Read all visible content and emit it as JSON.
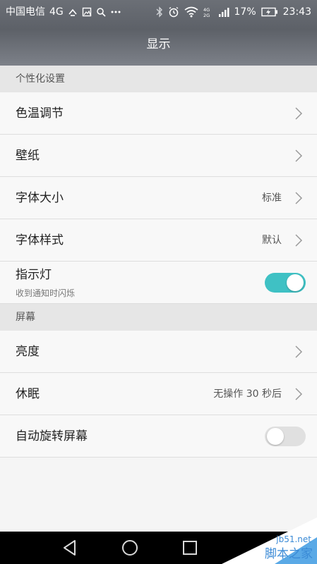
{
  "status_bar": {
    "carrier": "中国电信",
    "network": "4G",
    "battery_percent": "17%",
    "time": "23:43",
    "icons": [
      "usb-icon",
      "image-icon",
      "search-icon",
      "more-icon",
      "bluetooth-icon",
      "alarm-icon",
      "wifi-icon",
      "dual-4g-icon",
      "signal-icon",
      "battery-charging-icon"
    ]
  },
  "header": {
    "title": "显示"
  },
  "sections": {
    "personalization": {
      "header": "个性化设置",
      "color_temp": "色温调节",
      "wallpaper": "壁纸",
      "font_size": {
        "label": "字体大小",
        "value": "标准"
      },
      "font_style": {
        "label": "字体样式",
        "value": "默认"
      },
      "indicator": {
        "label": "指示灯",
        "sublabel": "收到通知时闪烁",
        "enabled": true
      }
    },
    "screen": {
      "header": "屏幕",
      "brightness": "亮度",
      "sleep": {
        "label": "休眠",
        "value": "无操作 30 秒后"
      },
      "auto_rotate": {
        "label": "自动旋转屏幕",
        "enabled": false
      }
    }
  },
  "navbar": {
    "buttons": [
      "back-icon",
      "home-icon",
      "recent-apps-icon"
    ]
  },
  "watermark": {
    "site": "jb51.net",
    "name": "脚本之家"
  },
  "colors": {
    "accent": "#3fc1c4",
    "header_bg": "#63676e",
    "section_bg": "#e6e6e6"
  }
}
